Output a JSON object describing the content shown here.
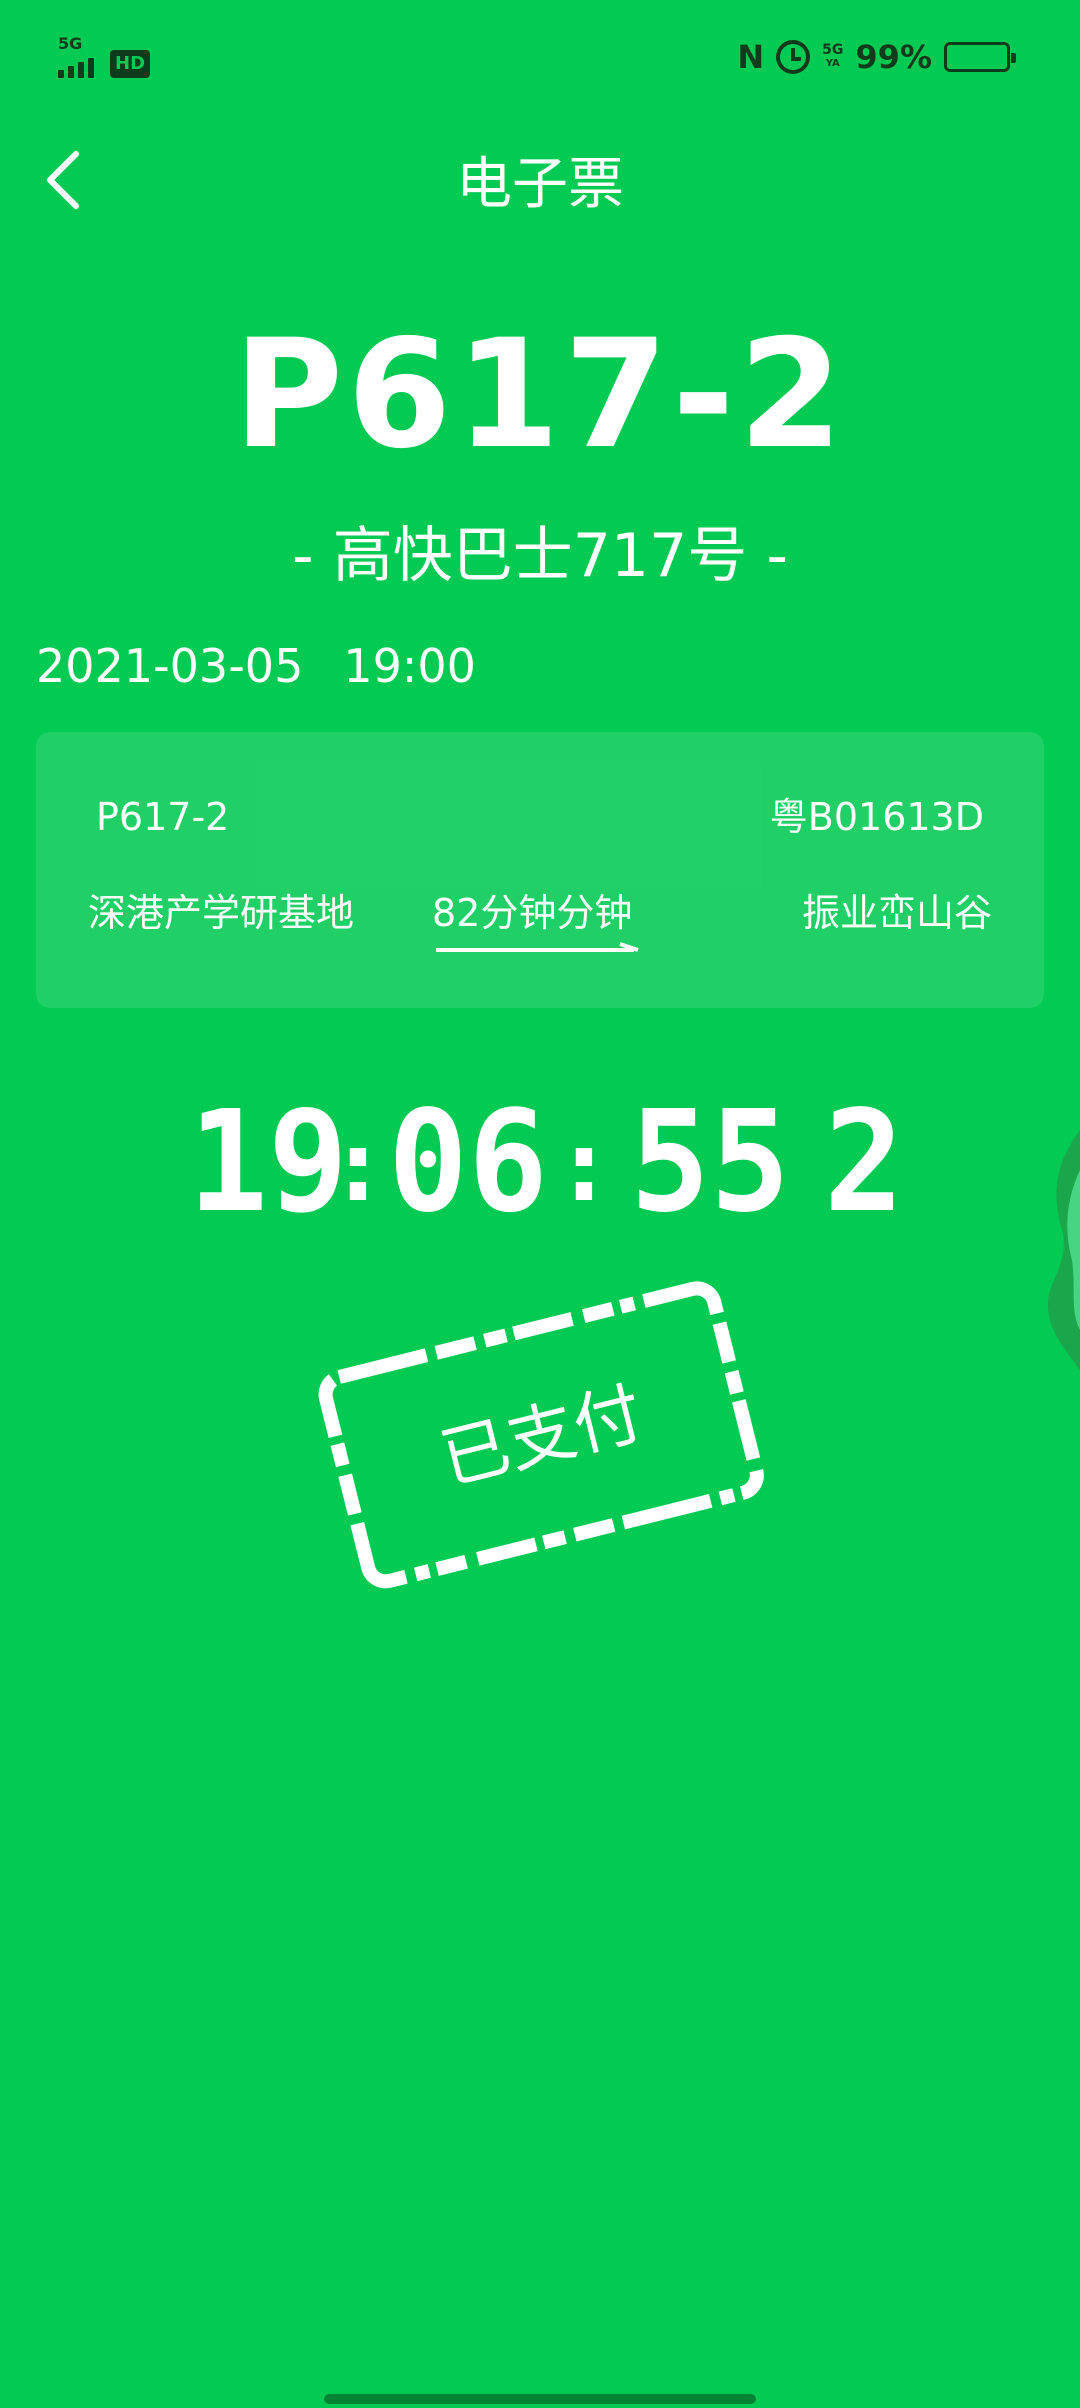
{
  "status_bar": {
    "network": "5G",
    "hd": "HD",
    "nfc": "N",
    "network2": "5G",
    "network2_sub": "YA",
    "battery": "99%"
  },
  "header": {
    "title": "电子票"
  },
  "ticket": {
    "route_code": "P617-2",
    "route_name": "- 高快巴士717号 -",
    "date": "2021-03-05",
    "time": "19:00",
    "card": {
      "route": "P617-2",
      "plate": "粤B01613D",
      "from": "深港产学研基地",
      "duration": "82分钟分钟",
      "to": "振业峦山谷"
    },
    "clock": {
      "hh": "19",
      "mm": "06",
      "ss": "55",
      "tick": "2"
    },
    "stamp_text": "已支付"
  },
  "colors": {
    "background": "#02ca52",
    "text": "#ffffff",
    "status": "#0d3b1b"
  }
}
